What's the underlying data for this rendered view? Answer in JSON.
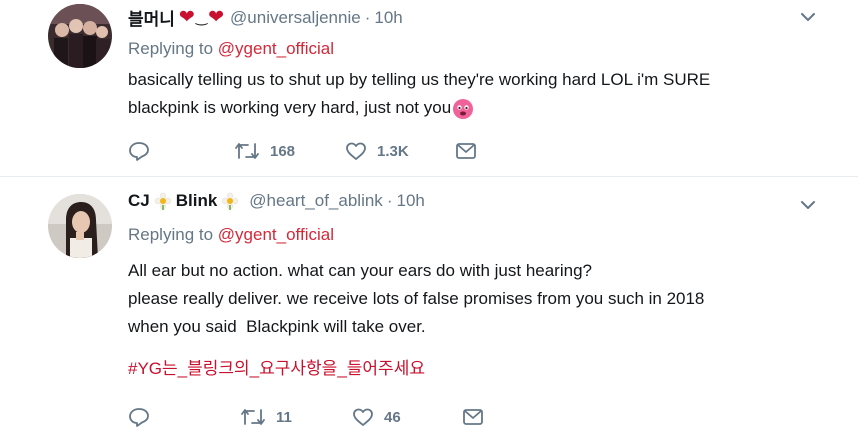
{
  "tweets": [
    {
      "display_name": "블머니",
      "handle": "@universaljennie",
      "separator": "·",
      "time": "10h",
      "reply_prefix": "Replying to",
      "reply_mention": "@ygent_official",
      "text_lines": [
        "basically telling us to shut up by telling us they're working hard LOL i'm SURE",
        "blackpink is working very hard, just not you"
      ],
      "retweets": "168",
      "likes": "1.3K"
    },
    {
      "display_name_parts": [
        "CJ",
        "Blink"
      ],
      "handle": "@heart_of_ablink",
      "separator": "·",
      "time": "10h",
      "reply_prefix": "Replying to",
      "reply_mention": "@ygent_official",
      "text_lines": [
        "All ear but no action. what can your ears do with just hearing?",
        "please really deliver. we receive lots of false promises from you such in 2018",
        "when you said  Blackpink will take over."
      ],
      "hashtag": "#YG는_블링크의_요구사항을_들어주세요",
      "retweets": "11",
      "likes": "46"
    }
  ],
  "colors": {
    "text": "#14171a",
    "muted": "#657786",
    "mention": "#c9102e",
    "divider": "#e6ecf0"
  },
  "icons": [
    "reply-icon",
    "retweet-icon",
    "like-icon",
    "message-icon",
    "caret-down-icon",
    "heart-emoji",
    "smile-glyph",
    "flower-emoji",
    "pleading-face-emoji"
  ]
}
